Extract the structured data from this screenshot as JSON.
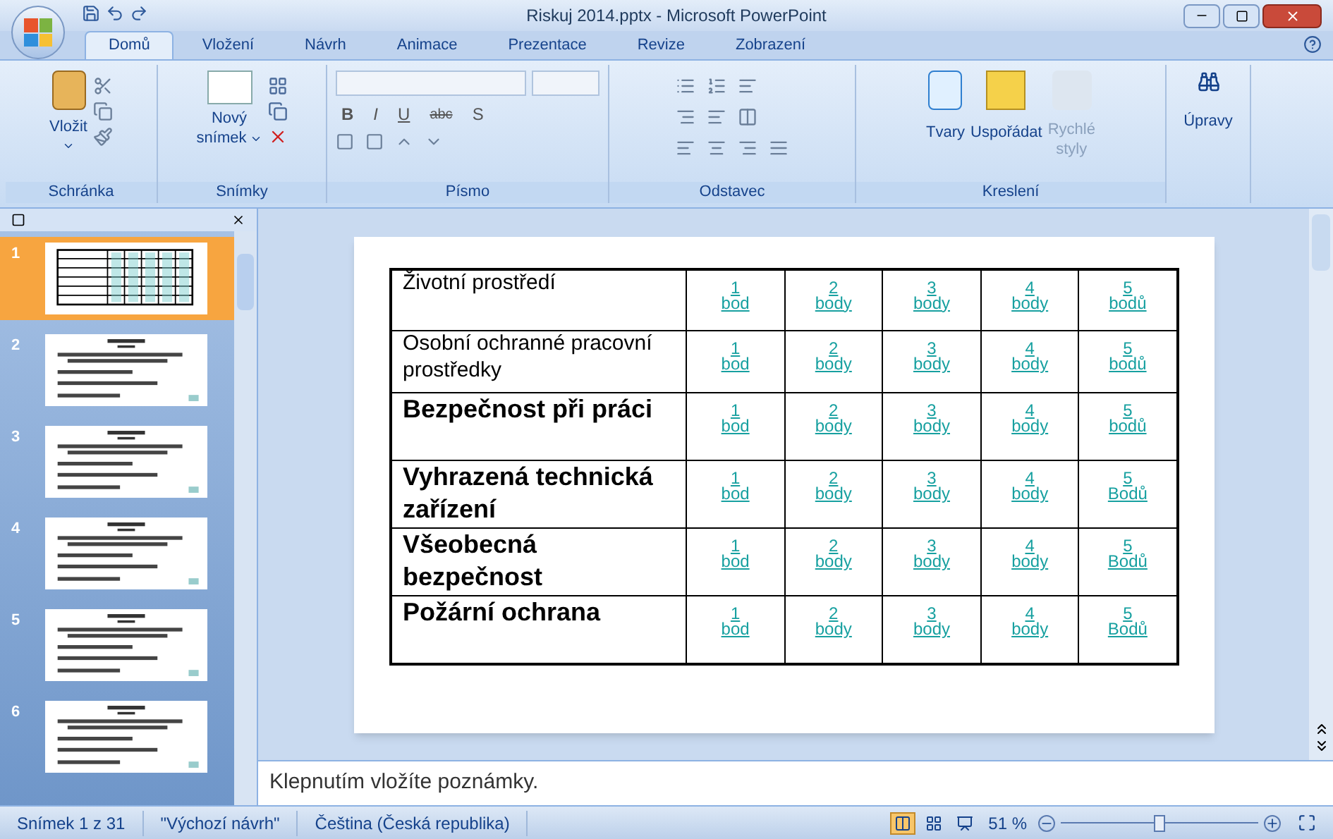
{
  "window": {
    "title": "Riskuj 2014.pptx - Microsoft PowerPoint"
  },
  "tabs": [
    {
      "label": "Domů",
      "selected": true
    },
    {
      "label": "Vložení",
      "selected": false
    },
    {
      "label": "Návrh",
      "selected": false
    },
    {
      "label": "Animace",
      "selected": false
    },
    {
      "label": "Prezentace",
      "selected": false
    },
    {
      "label": "Revize",
      "selected": false
    },
    {
      "label": "Zobrazení",
      "selected": false
    }
  ],
  "ribbon": {
    "clipboard": {
      "label": "Schránka",
      "paste": "Vložit"
    },
    "slides": {
      "label": "Snímky",
      "new_slide": "Nový",
      "new_slide_2": "snímek"
    },
    "font": {
      "label": "Písmo",
      "buttons": [
        "B",
        "I",
        "U",
        "abc",
        "S"
      ]
    },
    "paragraph": {
      "label": "Odstavec"
    },
    "drawing": {
      "label": "Kreslení",
      "shapes": "Tvary",
      "arrange": "Uspořádat",
      "quick_styles": "Rychlé",
      "quick_styles_2": "styly"
    },
    "editing": {
      "label": "Úpravy"
    }
  },
  "slides_pane": {
    "slides": [
      {
        "number": "1",
        "selected": true,
        "kind": "table"
      },
      {
        "number": "2",
        "selected": false,
        "kind": "text"
      },
      {
        "number": "3",
        "selected": false,
        "kind": "text"
      },
      {
        "number": "4",
        "selected": false,
        "kind": "text"
      },
      {
        "number": "5",
        "selected": false,
        "kind": "text"
      },
      {
        "number": "6",
        "selected": false,
        "kind": "text"
      }
    ]
  },
  "slide_table": {
    "rows": [
      {
        "label": "Životní prostředí",
        "kind": "small",
        "points": [
          {
            "number": "1",
            "word": "bod"
          },
          {
            "number": "2",
            "word": "body"
          },
          {
            "number": "3",
            "word": "body"
          },
          {
            "number": "4",
            "word": "body"
          },
          {
            "number": "5",
            "word": "bodů"
          }
        ]
      },
      {
        "label": "Osobní ochranné pracovní prostředky",
        "kind": "small",
        "points": [
          {
            "number": "1",
            "word": "bod"
          },
          {
            "number": "2",
            "word": "body"
          },
          {
            "number": "3",
            "word": "body"
          },
          {
            "number": "4",
            "word": "body"
          },
          {
            "number": "5",
            "word": "bodů"
          }
        ]
      },
      {
        "label": "Bezpečnost při práci",
        "kind": "large",
        "points": [
          {
            "number": "1",
            "word": "bod"
          },
          {
            "number": "2",
            "word": "body"
          },
          {
            "number": "3",
            "word": "body"
          },
          {
            "number": "4",
            "word": "body"
          },
          {
            "number": "5",
            "word": "bodů"
          }
        ]
      },
      {
        "label": "Vyhrazená technická zařízení",
        "kind": "large",
        "points": [
          {
            "number": "1",
            "word": "bod"
          },
          {
            "number": "2",
            "word": "body"
          },
          {
            "number": "3",
            "word": "body"
          },
          {
            "number": "4",
            "word": "body"
          },
          {
            "number": "5",
            "word": "Bodů"
          }
        ]
      },
      {
        "label": "Všeobecná bezpečnost",
        "kind": "large",
        "points": [
          {
            "number": "1",
            "word": "bod"
          },
          {
            "number": "2",
            "word": "body"
          },
          {
            "number": "3",
            "word": "body"
          },
          {
            "number": "4",
            "word": "body"
          },
          {
            "number": "5",
            "word": "Bodů"
          }
        ]
      },
      {
        "label": "Požární ochrana",
        "kind": "large",
        "points": [
          {
            "number": "1",
            "word": "bod"
          },
          {
            "number": "2",
            "word": "body"
          },
          {
            "number": "3",
            "word": "body"
          },
          {
            "number": "4",
            "word": "body"
          },
          {
            "number": "5",
            "word": "Bodů"
          }
        ]
      }
    ]
  },
  "notes": {
    "placeholder": "Klepnutím vložíte poznámky."
  },
  "status_bar": {
    "slide": "Snímek 1 z 31",
    "theme": "\"Výchozí návrh\"",
    "language": "Čeština (Česká republika)",
    "views": [
      {
        "kind": "normal",
        "selected": true
      },
      {
        "kind": "sorter",
        "selected": false
      },
      {
        "kind": "show",
        "selected": false
      }
    ],
    "zoom": "51 %",
    "zoom_level": {
      "level": 0.5
    }
  }
}
